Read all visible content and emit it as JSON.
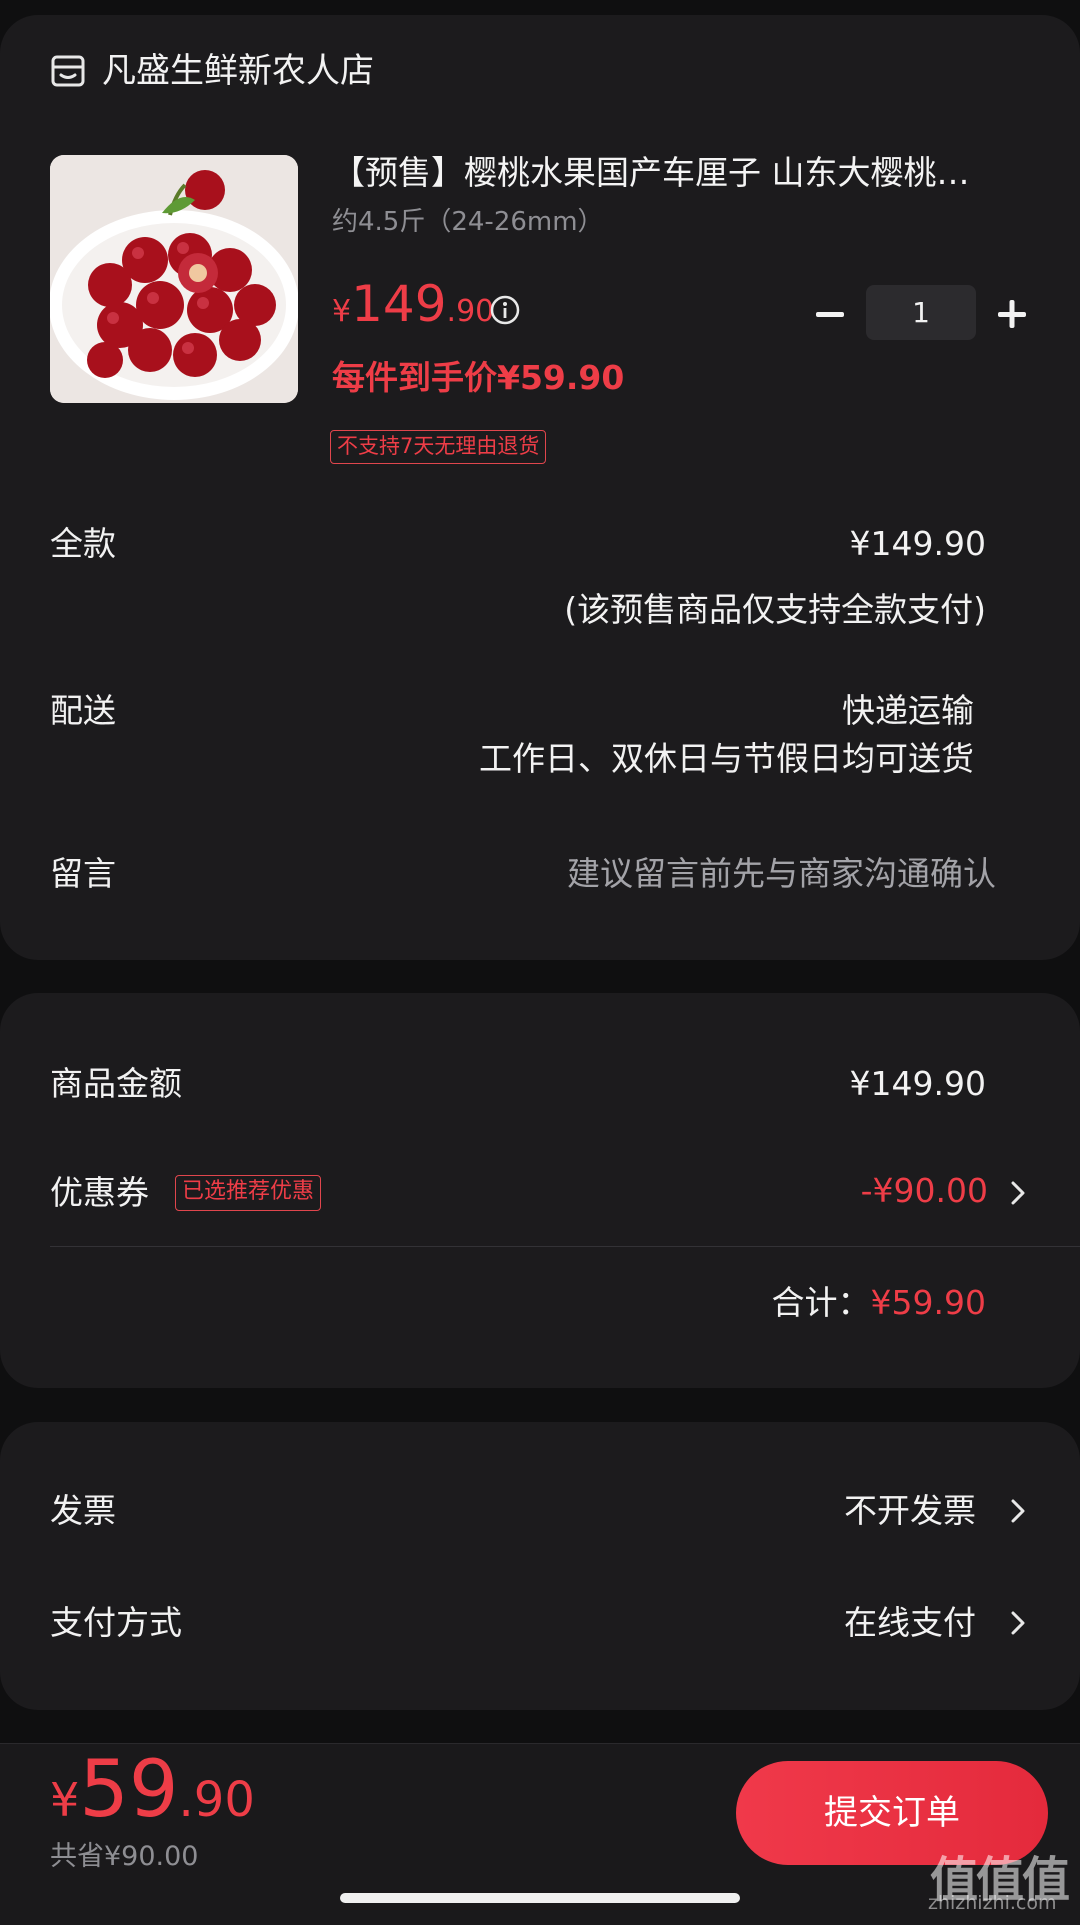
{
  "store": {
    "name": "凡盛生鲜新农人店"
  },
  "product": {
    "title": "【预售】樱桃水果国产车厘子 山东大樱桃…",
    "spec": "约4.5斤（24-26mm）",
    "price_currency": "¥",
    "price_int": "149",
    "price_dec": ".90",
    "per_price": "每件到手价¥59.90",
    "no_return_tag": "不支持7天无理由退货",
    "quantity": "1"
  },
  "rows": {
    "full_label": "全款",
    "full_value": "¥149.90",
    "full_note": "(该预售商品仅支持全款支付)",
    "delivery_label": "配送",
    "delivery_value": "快递运输",
    "delivery_note": "工作日、双休日与节假日均可送货",
    "message_label": "留言",
    "message_placeholder": "建议留言前先与商家沟通确认"
  },
  "amount": {
    "goods_label": "商品金额",
    "goods_value": "¥149.90",
    "coupon_label": "优惠券",
    "coupon_tag": "已选推荐优惠",
    "coupon_value": "-¥90.00",
    "total_label": "合计：",
    "total_value": "¥59.90"
  },
  "payment": {
    "invoice_label": "发票",
    "invoice_value": "不开发票",
    "method_label": "支付方式",
    "method_value": "在线支付"
  },
  "footer": {
    "total_currency": "¥",
    "total_int": "59",
    "total_dec": ".90",
    "saved": "共省¥90.00",
    "submit_label": "提交订单"
  },
  "watermark": {
    "main": "值值值",
    "sub": "zhizhizhi.com"
  },
  "colors": {
    "accent": "#ee3d47",
    "card": "#1c1b1d",
    "background": "#0f0f10"
  }
}
